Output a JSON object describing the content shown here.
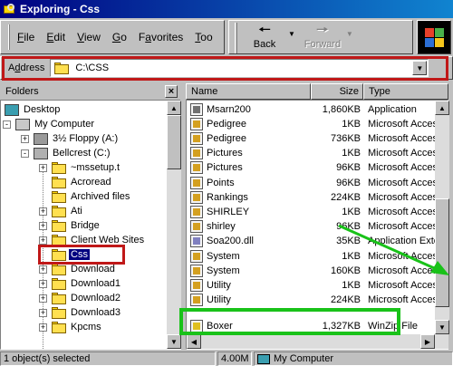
{
  "window": {
    "title": "Exploring - Css"
  },
  "menu": [
    "File",
    "Edit",
    "View",
    "Go",
    "Favorites",
    "Too"
  ],
  "menu_underline": [
    "F",
    "E",
    "V",
    "G",
    "a",
    "T"
  ],
  "toolbar": {
    "back_label": "Back",
    "forward_label": "Forward"
  },
  "address": {
    "label": "Address",
    "label_underline": "d",
    "value": "C:\\CSS"
  },
  "folders_pane": {
    "header": "Folders",
    "close_glyph": "×",
    "items": [
      {
        "label": "Desktop",
        "icon": "desktop-icon"
      },
      {
        "label": "My Computer",
        "icon": "computer-icon",
        "expander": "-"
      },
      {
        "label": "3½ Floppy (A:)",
        "icon": "floppy-icon",
        "expander": "+"
      },
      {
        "label": "Bellcrest (C:)",
        "icon": "drive-icon",
        "expander": "-"
      },
      {
        "label": "~mssetup.t",
        "icon": "folder-icon",
        "expander": "+"
      },
      {
        "label": "Acroread",
        "icon": "folder-icon"
      },
      {
        "label": "Archived files",
        "icon": "folder-icon"
      },
      {
        "label": "Ati",
        "icon": "folder-icon",
        "expander": "+"
      },
      {
        "label": "Bridge",
        "icon": "folder-icon",
        "expander": "+"
      },
      {
        "label": "Client Web Sites",
        "icon": "folder-icon",
        "expander": "+"
      },
      {
        "label": "Css",
        "icon": "open-folder-icon",
        "selected": true
      },
      {
        "label": "Download",
        "icon": "folder-icon",
        "expander": "+"
      },
      {
        "label": "Download1",
        "icon": "folder-icon",
        "expander": "+"
      },
      {
        "label": "Download2",
        "icon": "folder-icon",
        "expander": "+"
      },
      {
        "label": "Download3",
        "icon": "folder-icon",
        "expander": "+"
      },
      {
        "label": "Kpcms",
        "icon": "folder-icon",
        "expander": "+"
      }
    ]
  },
  "file_list": {
    "columns": [
      "Name",
      "Size",
      "Type"
    ],
    "rows": [
      {
        "name": "Msarn200",
        "size": "1,860KB",
        "type": "Application",
        "icon": "application-icon"
      },
      {
        "name": "Pedigree",
        "size": "1KB",
        "type": "Microsoft Access Rec",
        "icon": "access-icon"
      },
      {
        "name": "Pedigree",
        "size": "736KB",
        "type": "Microsoft Access Dat",
        "icon": "access-icon"
      },
      {
        "name": "Pictures",
        "size": "1KB",
        "type": "Microsoft Access Rec",
        "icon": "access-icon"
      },
      {
        "name": "Pictures",
        "size": "96KB",
        "type": "Microsoft Access Dat",
        "icon": "access-icon"
      },
      {
        "name": "Points",
        "size": "96KB",
        "type": "Microsoft Access Dat",
        "icon": "access-icon"
      },
      {
        "name": "Rankings",
        "size": "224KB",
        "type": "Microsoft Access Dat",
        "icon": "access-icon"
      },
      {
        "name": "SHIRLEY",
        "size": "1KB",
        "type": "Microsoft Access Rec",
        "icon": "access-icon"
      },
      {
        "name": "shirley",
        "size": "96KB",
        "type": "Microsoft Access Dat",
        "icon": "access-icon"
      },
      {
        "name": "Soa200.dll",
        "size": "35KB",
        "type": "Application Extension",
        "icon": "dll-icon"
      },
      {
        "name": "System",
        "size": "1KB",
        "type": "Microsoft Access Rec",
        "icon": "access-icon"
      },
      {
        "name": "System",
        "size": "160KB",
        "type": "Microsoft Access Add",
        "icon": "access-icon"
      },
      {
        "name": "Utility",
        "size": "1KB",
        "type": "Microsoft Access Rec",
        "icon": "access-icon"
      },
      {
        "name": "Utility",
        "size": "224KB",
        "type": "Microsoft Access Add",
        "icon": "access-icon"
      },
      {
        "name": "Boxer",
        "size": "1,327KB",
        "type": "WinZip File",
        "icon": "winzip-icon"
      }
    ]
  },
  "status": {
    "selection": "1 object(s) selected",
    "size": "4.00M",
    "location": "My Computer"
  },
  "colors": {
    "titlebar": "#000080",
    "selection": "#000080",
    "annotation_red": "#c01818",
    "annotation_green": "#19c219"
  }
}
